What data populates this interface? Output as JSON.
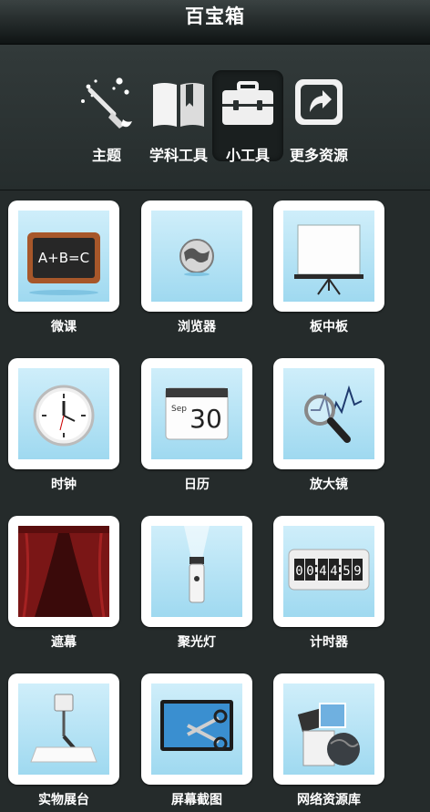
{
  "header": {
    "title": "百宝箱"
  },
  "tabs": [
    {
      "label": "主题",
      "icon": "paintbrush-icon",
      "active": false
    },
    {
      "label": "学科工具",
      "icon": "book-icon",
      "active": false
    },
    {
      "label": "小工具",
      "icon": "toolbox-icon",
      "active": true
    },
    {
      "label": "更多资源",
      "icon": "external-link-icon",
      "active": false
    }
  ],
  "tools": [
    {
      "label": "微课",
      "icon": "chalkboard-icon",
      "board_text": "A+B=C"
    },
    {
      "label": "浏览器",
      "icon": "globe-icon"
    },
    {
      "label": "板中板",
      "icon": "projector-screen-icon"
    },
    {
      "label": "时钟",
      "icon": "clock-icon"
    },
    {
      "label": "日历",
      "icon": "calendar-icon",
      "month": "Sep",
      "day": "30"
    },
    {
      "label": "放大镜",
      "icon": "magnifier-icon"
    },
    {
      "label": "遮幕",
      "icon": "curtain-icon"
    },
    {
      "label": "聚光灯",
      "icon": "spotlight-icon"
    },
    {
      "label": "计时器",
      "icon": "timer-icon",
      "digits": [
        "0",
        "0",
        "4",
        "4",
        "5",
        "9"
      ]
    },
    {
      "label": "实物展台",
      "icon": "document-camera-icon"
    },
    {
      "label": "屏幕截图",
      "icon": "screenshot-scissors-icon"
    },
    {
      "label": "网络资源库",
      "icon": "network-resources-icon"
    }
  ],
  "colors": {
    "background": "#252b2b",
    "tile_bg": "#ffffff",
    "pic_bg": "#aee0f3"
  }
}
